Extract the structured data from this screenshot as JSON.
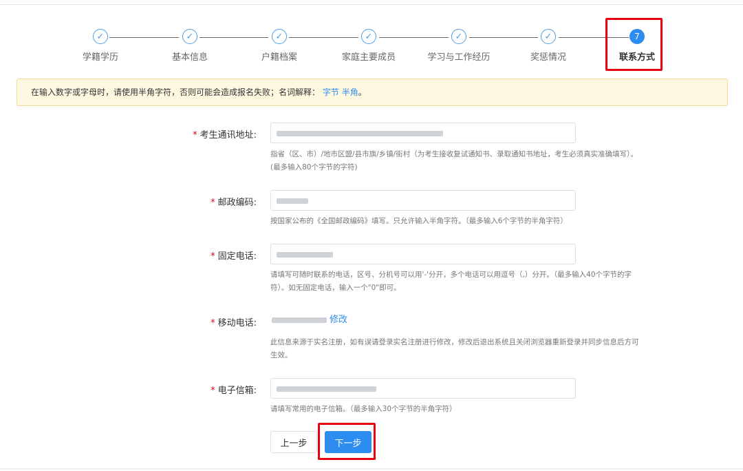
{
  "steps": [
    {
      "label": "学籍学历",
      "marker": "✓",
      "status": "done"
    },
    {
      "label": "基本信息",
      "marker": "✓",
      "status": "done"
    },
    {
      "label": "户籍档案",
      "marker": "✓",
      "status": "done"
    },
    {
      "label": "家庭主要成员",
      "marker": "✓",
      "status": "done"
    },
    {
      "label": "学习与工作经历",
      "marker": "✓",
      "status": "done"
    },
    {
      "label": "奖惩情况",
      "marker": "✓",
      "status": "done"
    },
    {
      "label": "联系方式",
      "marker": "7",
      "status": "active"
    }
  ],
  "notice": {
    "text": "在输入数字或字母时，请使用半角字符，否则可能会造成报名失败；名词解释：",
    "link_byte": "字节",
    "link_halfwidth": "半角",
    "end": "。"
  },
  "form": {
    "address": {
      "label": "考生通讯地址:",
      "hint_line1": "指省（区、市）/地市区盟/县市旗/乡镇/街村（为考生接收复试通知书、录取通知书地址，考生必须真实准确填写）。",
      "hint_line2": "(最多输入80个字节的字符)"
    },
    "postcode": {
      "label": "邮政编码:",
      "hint": "按国家公布的《全国邮政编码》填写。只允许输入半角字符。（最多输入6个字节的半角字符）"
    },
    "phone": {
      "label": "固定电话:",
      "hint_line1": "请填写可随时联系的电话，区号、分机号可以用'-'分开，多个电话可以用逗号（,）分开。（最多输入40个字节的字",
      "hint_line2": "符）。如无固定电话，输入一个\"0\"即可。"
    },
    "mobile": {
      "label": "移动电话:",
      "edit_link": "修改",
      "hint_line1": "此信息来源于实名注册，如有误请登录实名注册进行修改，修改后退出系统且关闭浏览器重新登录并同步信息后方可",
      "hint_line2": "生效。"
    },
    "email": {
      "label": "电子信箱:",
      "hint": "请填写常用的电子信箱。（最多输入30个字节的半角字符）"
    }
  },
  "buttons": {
    "prev": "上一步",
    "next": "下一步"
  },
  "colors": {
    "primary": "#2d8cf0",
    "required": "#e60012",
    "highlight_box": "#e60012",
    "notice_bg": "#fff8e1"
  }
}
